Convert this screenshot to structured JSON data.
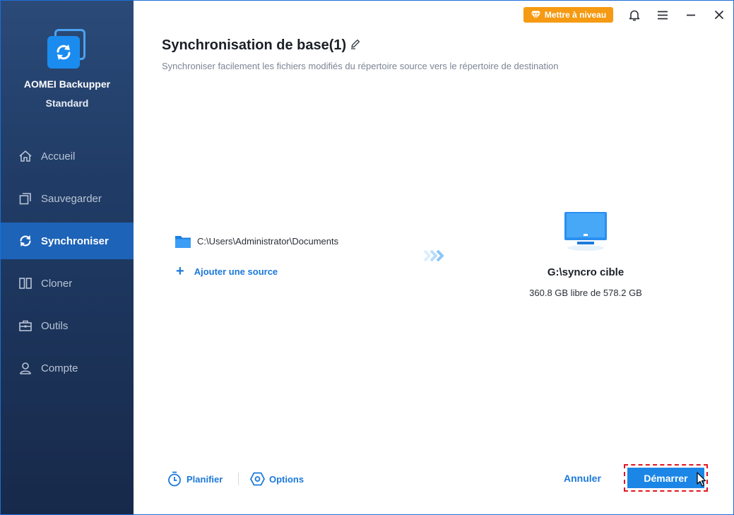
{
  "app": {
    "name": "AOMEI Backupper",
    "edition": "Standard",
    "logo_icon": "sync-logo-icon"
  },
  "titlebar": {
    "upgrade_label": "Mettre à niveau",
    "upgrade_icon": "diamond-icon",
    "icons": [
      "bell-icon",
      "menu-icon",
      "minimize-icon",
      "close-icon"
    ]
  },
  "sidebar": {
    "items": [
      {
        "label": "Accueil",
        "icon": "home-icon",
        "active": false
      },
      {
        "label": "Sauvegarder",
        "icon": "backup-icon",
        "active": false
      },
      {
        "label": "Synchroniser",
        "icon": "sync-icon",
        "active": true
      },
      {
        "label": "Cloner",
        "icon": "clone-icon",
        "active": false
      },
      {
        "label": "Outils",
        "icon": "toolbox-icon",
        "active": false
      },
      {
        "label": "Compte",
        "icon": "user-icon",
        "active": false
      }
    ]
  },
  "header": {
    "title": "Synchronisation de base(1)",
    "subtitle": "Synchroniser facilement les fichiers modifiés du répertoire source vers le répertoire de destination"
  },
  "source": {
    "path": "C:\\Users\\Administrator\\Documents",
    "add_label": "Ajouter une source"
  },
  "destination": {
    "name": "G:\\syncro cible",
    "space": "360.8 GB libre de 578.2 GB"
  },
  "footer": {
    "schedule_label": "Planifier",
    "options_label": "Options",
    "cancel_label": "Annuler",
    "start_label": "Démarrer"
  },
  "colors": {
    "accent": "#1b78d9",
    "sidebar_active": "#1d63b8",
    "upgrade": "#f59a12",
    "highlight_outline": "#e0161f"
  }
}
